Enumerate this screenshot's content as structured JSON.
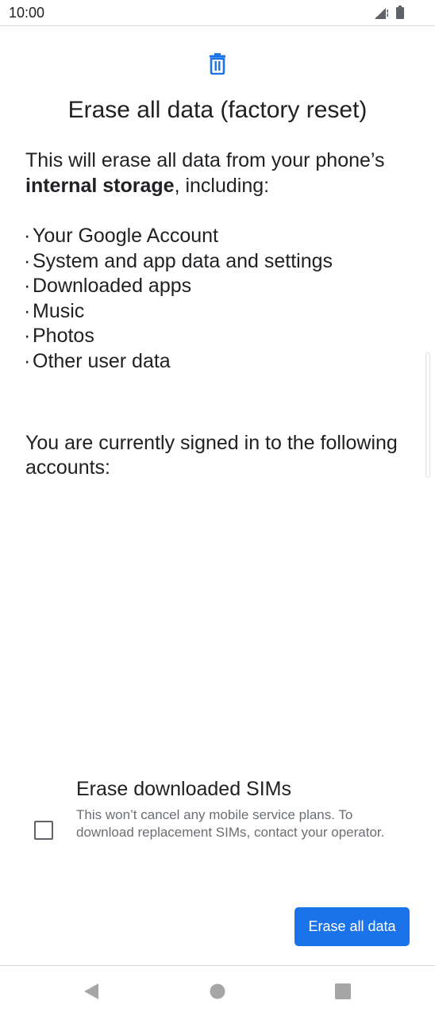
{
  "status_bar": {
    "time": "10:00",
    "icons": [
      "signal-icon",
      "battery-icon"
    ]
  },
  "dialog": {
    "icon": "trash-icon",
    "icon_color": "#1a73e8",
    "title": "Erase all data (factory reset)",
    "intro_prefix": "This will erase all data from your phone’s ",
    "intro_bold": "internal storage",
    "intro_suffix": ", including:",
    "bullet_char": "·",
    "items": [
      "Your Google Account",
      "System and app data and settings",
      "Downloaded apps",
      "Music",
      "Photos",
      "Other user data"
    ],
    "accounts_text": "You are currently signed in to the following accounts:"
  },
  "sim_option": {
    "title": "Erase downloaded SIMs",
    "description": "This won’t cancel any mobile service plans. To download replacement SIMs, contact your operator.",
    "checked": false
  },
  "actions": {
    "erase_label": "Erase all data",
    "button_color": "#1a73e8"
  },
  "nav_bar": {
    "buttons": [
      "back-icon",
      "home-icon",
      "recents-icon"
    ]
  }
}
